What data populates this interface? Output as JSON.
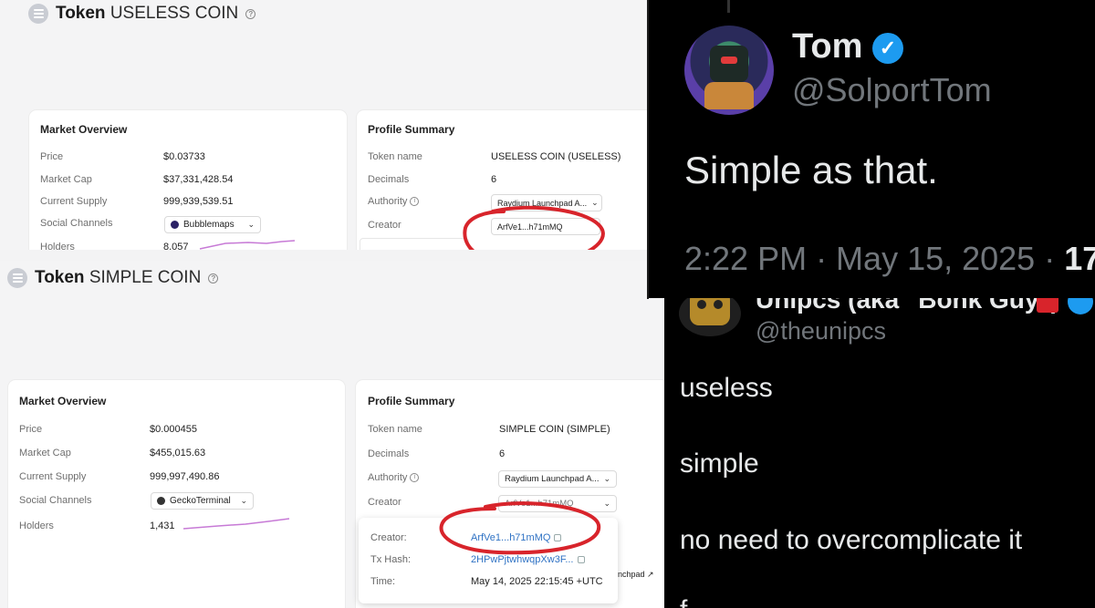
{
  "top_token": {
    "label": "Token",
    "name": "USELESS COIN",
    "market": {
      "title": "Market Overview",
      "rows": [
        {
          "label": "Price",
          "value": "$0.03733"
        },
        {
          "label": "Market Cap",
          "value": "$37,331,428.54"
        },
        {
          "label": "Current Supply",
          "value": "999,939,539.51"
        },
        {
          "label": "Social Channels",
          "value": "Bubblemaps"
        },
        {
          "label": "Holders",
          "value": "8,057"
        }
      ]
    },
    "profile": {
      "title": "Profile Summary",
      "rows": [
        {
          "label": "Token name",
          "value": "USELESS COIN (USELESS)"
        },
        {
          "label": "Decimals",
          "value": "6"
        },
        {
          "label": "Authority",
          "value": "Raydium Launchpad A..."
        },
        {
          "label": "Creator",
          "value": "ArfVe1...h71mMQ"
        }
      ]
    }
  },
  "bottom_token": {
    "label": "Token",
    "name": "SIMPLE COIN",
    "market": {
      "title": "Market Overview",
      "rows": [
        {
          "label": "Price",
          "value": "$0.000455"
        },
        {
          "label": "Market Cap",
          "value": "$455,015.63"
        },
        {
          "label": "Current Supply",
          "value": "999,997,490.86"
        },
        {
          "label": "Social Channels",
          "value": "GeckoTerminal"
        },
        {
          "label": "Holders",
          "value": "1,431"
        }
      ]
    },
    "profile": {
      "title": "Profile Summary",
      "rows": [
        {
          "label": "Token name",
          "value": "SIMPLE COIN (SIMPLE)"
        },
        {
          "label": "Decimals",
          "value": "6"
        },
        {
          "label": "Authority",
          "value": "Raydium Launchpad A..."
        },
        {
          "label": "Creator",
          "value": "ArfVe1...h71mMQ"
        }
      ]
    },
    "popup": {
      "creator_label": "Creator:",
      "creator_value": "ArfVe1...h71mMQ",
      "tx_label": "Tx Hash:",
      "tx_value": "2HPwPjtwhwqpXw3F...",
      "time_label": "Time:",
      "time_value": "May 14, 2025 22:15:45 +UTC",
      "side_text": "nchpad"
    }
  },
  "tweet_tom": {
    "name": "Tom",
    "handle": "@SolportTom",
    "text": "Simple as that.",
    "timestamp": "2:22 PM · May 15, 2025 ·",
    "extra": "17"
  },
  "tweet_unipcs": {
    "name": "Unipcs (aka \"Bonk Guy\")",
    "handle": "@theunipcs",
    "lines": [
      "useless",
      "simple",
      "no need to overcomplicate it"
    ],
    "cut_text": "f"
  },
  "colors": {
    "annotation_red": "#d8242b",
    "link_blue": "#2f72c4",
    "verified_blue": "#1d9bf0",
    "sparkline": "#c77ad6"
  }
}
